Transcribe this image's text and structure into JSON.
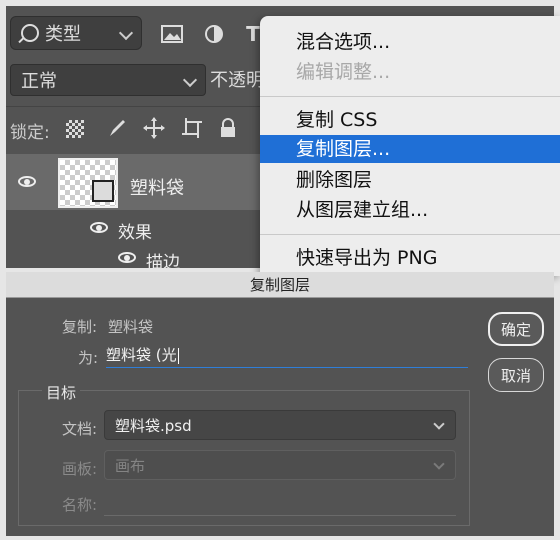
{
  "layers_panel": {
    "filter_kind": "类型",
    "blend_mode": "正常",
    "opacity_label": "不透明",
    "lock_label": "锁定:",
    "layer": {
      "name": "塑料袋",
      "effects_label": "效果",
      "stroke_label": "描边"
    }
  },
  "context_menu": {
    "items": [
      {
        "label": "混合选项...",
        "enabled": true
      },
      {
        "label": "编辑调整...",
        "enabled": false
      },
      {
        "label": "复制 CSS",
        "enabled": true
      },
      {
        "label": "复制图层...",
        "enabled": true,
        "highlighted": true
      },
      {
        "label": "删除图层",
        "enabled": true
      },
      {
        "label": "从图层建立组...",
        "enabled": true
      },
      {
        "label": "快速导出为 PNG",
        "enabled": true
      }
    ]
  },
  "dialog": {
    "title": "复制图层",
    "duplicate_label": "复制:",
    "duplicate_value": "塑料袋",
    "as_label": "为:",
    "as_value": "塑料袋 (光",
    "ok_label": "确定",
    "cancel_label": "取消",
    "destination": {
      "title": "目标",
      "document_label": "文档:",
      "document_value": "塑料袋.psd",
      "artboard_label": "画板:",
      "artboard_value": "画布",
      "name_label": "名称:",
      "name_value": ""
    }
  },
  "colors": {
    "highlight": "#1f6fd6",
    "panel_bg": "#535353",
    "menu_bg": "#ededed",
    "focus_underline": "#2f7ed8"
  }
}
